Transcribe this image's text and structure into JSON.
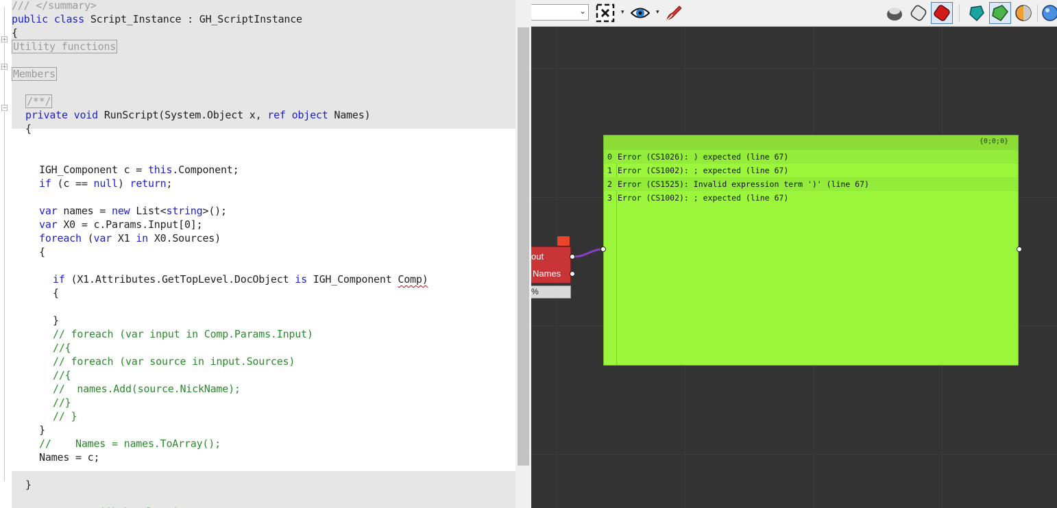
{
  "editor": {
    "lines": [
      {
        "indent": 0,
        "parts": [
          {
            "t": "/// </summary>",
            "c": "gray"
          }
        ]
      },
      {
        "indent": 0,
        "parts": [
          {
            "t": "public class ",
            "c": "kw"
          },
          {
            "t": "Script_Instance : GH_ScriptInstance",
            "c": ""
          }
        ]
      },
      {
        "indent": 0,
        "parts": [
          {
            "t": "{",
            "c": ""
          }
        ]
      },
      {
        "indent": 0,
        "parts": [
          {
            "t": "Utility functions",
            "c": "boxed"
          }
        ]
      },
      {
        "indent": 0,
        "parts": []
      },
      {
        "indent": 0,
        "parts": [
          {
            "t": "Members",
            "c": "boxed"
          }
        ]
      },
      {
        "indent": 0,
        "parts": []
      },
      {
        "indent": 2,
        "parts": [
          {
            "t": "/**/",
            "c": "boxed"
          }
        ]
      },
      {
        "indent": 2,
        "parts": [
          {
            "t": "private void ",
            "c": "kw"
          },
          {
            "t": "RunScript(System.Object x, ",
            "c": ""
          },
          {
            "t": "ref object",
            "c": "kw"
          },
          {
            "t": " Names)",
            "c": ""
          }
        ]
      },
      {
        "indent": 2,
        "parts": [
          {
            "t": "{",
            "c": ""
          }
        ]
      },
      {
        "indent": 0,
        "parts": []
      },
      {
        "indent": 0,
        "parts": []
      },
      {
        "indent": 4,
        "parts": [
          {
            "t": "IGH_Component c = ",
            "c": ""
          },
          {
            "t": "this",
            "c": "kw"
          },
          {
            "t": ".Component;",
            "c": ""
          }
        ]
      },
      {
        "indent": 4,
        "parts": [
          {
            "t": "if",
            "c": "kw"
          },
          {
            "t": " (c == ",
            "c": ""
          },
          {
            "t": "null",
            "c": "kw"
          },
          {
            "t": ") ",
            "c": ""
          },
          {
            "t": "return",
            "c": "kw"
          },
          {
            "t": ";",
            "c": ""
          }
        ]
      },
      {
        "indent": 0,
        "parts": []
      },
      {
        "indent": 4,
        "parts": [
          {
            "t": "var",
            "c": "kw"
          },
          {
            "t": " names = ",
            "c": ""
          },
          {
            "t": "new",
            "c": "kw"
          },
          {
            "t": " List<",
            "c": ""
          },
          {
            "t": "string",
            "c": "kw"
          },
          {
            "t": ">();",
            "c": ""
          }
        ]
      },
      {
        "indent": 4,
        "parts": [
          {
            "t": "var",
            "c": "kw"
          },
          {
            "t": " X0 = c.Params.Input[0];",
            "c": ""
          }
        ]
      },
      {
        "indent": 4,
        "parts": [
          {
            "t": "foreach",
            "c": "kw"
          },
          {
            "t": " (",
            "c": ""
          },
          {
            "t": "var",
            "c": "kw"
          },
          {
            "t": " X1 ",
            "c": ""
          },
          {
            "t": "in",
            "c": "kw"
          },
          {
            "t": " X0.Sources)",
            "c": ""
          }
        ]
      },
      {
        "indent": 4,
        "parts": [
          {
            "t": "{",
            "c": ""
          }
        ]
      },
      {
        "indent": 0,
        "parts": []
      },
      {
        "indent": 6,
        "parts": [
          {
            "t": "if",
            "c": "kw"
          },
          {
            "t": " (X1.Attributes.GetTopLevel.DocObject ",
            "c": ""
          },
          {
            "t": "is",
            "c": "kw"
          },
          {
            "t": " IGH_Component ",
            "c": ""
          },
          {
            "t": "Comp)",
            "c": "squig"
          }
        ]
      },
      {
        "indent": 6,
        "parts": [
          {
            "t": "{",
            "c": ""
          }
        ]
      },
      {
        "indent": 0,
        "parts": []
      },
      {
        "indent": 6,
        "parts": [
          {
            "t": "}",
            "c": ""
          }
        ]
      },
      {
        "indent": 6,
        "parts": [
          {
            "t": "// foreach (var input in Comp.Params.Input)",
            "c": "cm"
          }
        ]
      },
      {
        "indent": 6,
        "parts": [
          {
            "t": "//{",
            "c": "cm"
          }
        ]
      },
      {
        "indent": 6,
        "parts": [
          {
            "t": "// foreach (var source in input.Sources)",
            "c": "cm"
          }
        ]
      },
      {
        "indent": 6,
        "parts": [
          {
            "t": "//{",
            "c": "cm"
          }
        ]
      },
      {
        "indent": 6,
        "parts": [
          {
            "t": "//  names.Add(source.NickName);",
            "c": "cm"
          }
        ]
      },
      {
        "indent": 6,
        "parts": [
          {
            "t": "//}",
            "c": "cm"
          }
        ]
      },
      {
        "indent": 6,
        "parts": [
          {
            "t": "// }",
            "c": "cm"
          }
        ]
      },
      {
        "indent": 4,
        "parts": [
          {
            "t": "}",
            "c": ""
          }
        ]
      },
      {
        "indent": 4,
        "parts": [
          {
            "t": "//    Names = names.ToArray();",
            "c": "cm"
          }
        ]
      },
      {
        "indent": 4,
        "parts": [
          {
            "t": "Names = c;",
            "c": ""
          }
        ]
      },
      {
        "indent": 0,
        "parts": []
      },
      {
        "indent": 2,
        "parts": [
          {
            "t": "}",
            "c": ""
          }
        ]
      },
      {
        "indent": 0,
        "parts": []
      },
      {
        "indent": 2,
        "parts": [
          {
            "t": "// <Custom additional code>",
            "c": "cm"
          }
        ]
      }
    ]
  },
  "toolbar": {
    "icons": [
      "zoom-extents-icon",
      "preview-eye-icon",
      "sketch-brush-icon",
      "preview-wireframe-icon",
      "preview-shaded-icon",
      "preview-selected-icon",
      "cyan-gem-icon",
      "green-gem-icon",
      "orange-sphere-icon",
      "blue-sphere-icon"
    ]
  },
  "component": {
    "outputs": [
      "out",
      "Names"
    ],
    "status": "%"
  },
  "panel": {
    "path": "{0;0;0}",
    "rows": [
      {
        "index": "0",
        "text": "Error (CS1026): ) expected (line 67)"
      },
      {
        "index": "1",
        "text": "Error (CS1002): ; expected (line 67)"
      },
      {
        "index": "2",
        "text": "Error (CS1525): Invalid expression term ')' (line 67)"
      },
      {
        "index": "3",
        "text": "Error (CS1002): ; expected (line 67)"
      }
    ]
  },
  "colors": {
    "keyword": "#1d1dcc",
    "comment": "#2b8a2b",
    "canvas": "#333333",
    "panel": "#9cf63c",
    "component": "#c93537",
    "wire": "#8a3fc7"
  }
}
